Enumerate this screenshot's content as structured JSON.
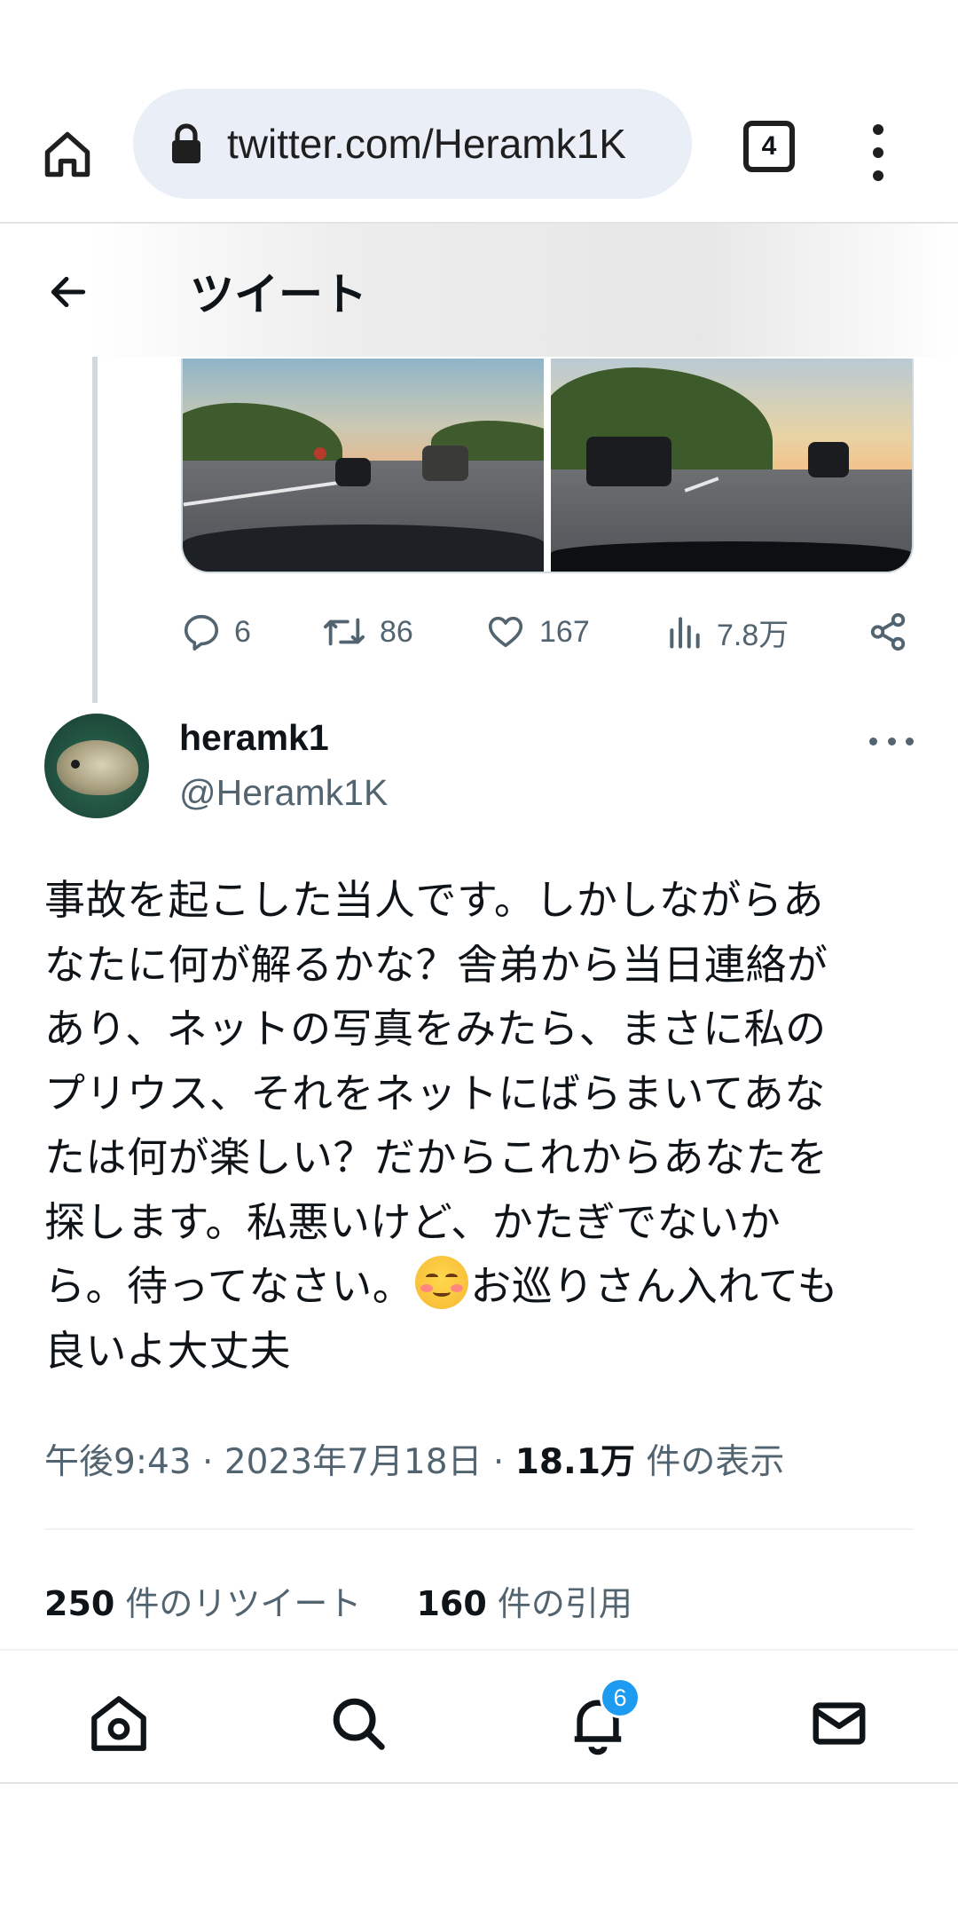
{
  "browser": {
    "url": "twitter.com/Heramk1K",
    "tab_count": "4"
  },
  "header": {
    "title": "ツイート"
  },
  "quoted_actions": {
    "replies": "6",
    "retweets": "86",
    "likes": "167",
    "views": "7.8万"
  },
  "tweet": {
    "display_name": "heramk1",
    "handle": "@Heramk1K",
    "text_lines": [
      "事故を起こした当人です。しかしながらあ",
      "なたに何が解るかな？舎弟から当日連絡が",
      "あり、ネットの写真をみたら、まさに私の",
      "プリウス、それをネットにばらまいてあな",
      "たは何が楽しい？だからこれからあなたを",
      "探します。私悪いけど、かたぎでないか",
      "ら。待ってなさい。",
      "お巡りさん入れても",
      "良いよ大丈夫"
    ],
    "emoji": "smiling-face-with-smiling-eyes",
    "time": "午後9:43",
    "date": "2023年7月18日",
    "views_count": "18.1万",
    "views_label": "件の表示",
    "separator": "·"
  },
  "stats": {
    "retweets_count": "250",
    "retweets_label": "件のリツイート",
    "quotes_count": "160",
    "quotes_label": "件の引用"
  },
  "bottom_nav": {
    "notifications_badge": "6"
  },
  "colors": {
    "accent": "#1d9bf0",
    "secondary_text": "#536471",
    "primary_text": "#0f1419",
    "url_bar": "#e9eef7"
  }
}
